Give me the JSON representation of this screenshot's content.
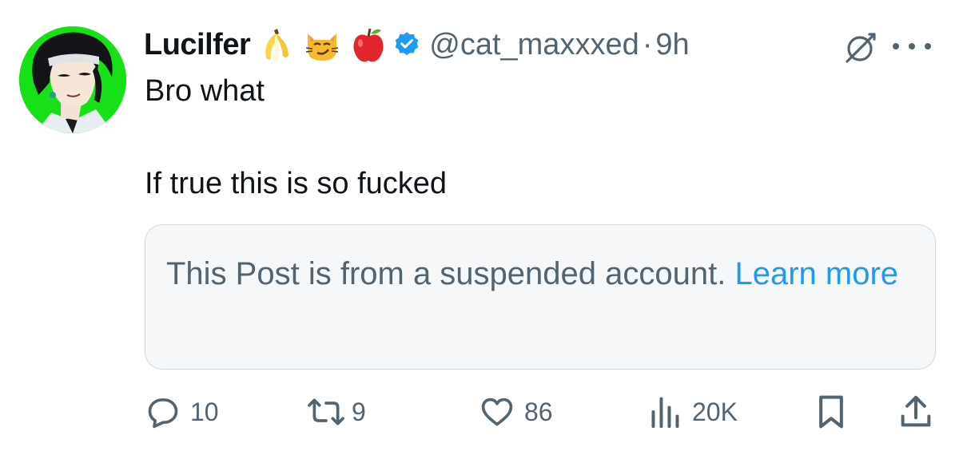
{
  "tweet": {
    "author_name": "Lucilfer",
    "handle": "@cat_maxxxed",
    "separator": "·",
    "time": "9h",
    "name_emojis": [
      "banana",
      "smirking-cat",
      "red-apple"
    ],
    "verified": true,
    "text_line1": "Bro what",
    "text_line2": "If true this is so fucked",
    "notice": {
      "text": "This Post is from a suspended account.",
      "link": "Learn more"
    },
    "actions": {
      "replies": "10",
      "reposts": "9",
      "likes": "86",
      "views": "20K"
    }
  },
  "colors": {
    "text_primary": "#0f1419",
    "text_secondary": "#536471",
    "link": "#1d9bf0",
    "avatar_bg": "#17e017",
    "verified": "#1d9bf0"
  },
  "icons": [
    "grok-icon",
    "more-icon",
    "reply-icon",
    "repost-icon",
    "like-icon",
    "views-icon",
    "bookmark-icon",
    "share-icon"
  ]
}
